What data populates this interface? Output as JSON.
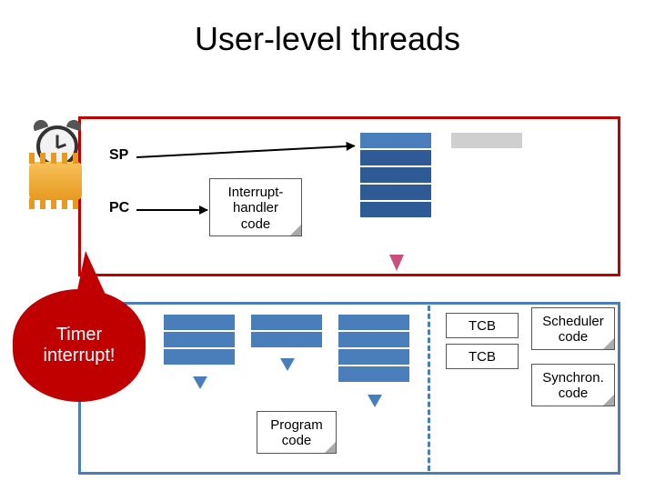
{
  "title": "User-level threads",
  "registers": {
    "sp": "SP",
    "pc": "PC"
  },
  "kernel": {
    "interrupt_handler_label": "Interrupt-\nhandler\ncode"
  },
  "balloon": {
    "text": "Timer\ninterrupt!"
  },
  "user": {
    "tcb1": "TCB",
    "tcb2": "TCB",
    "scheduler_label": "Scheduler\ncode",
    "synchron_label": "Synchron.\ncode",
    "program_label": "Program\ncode"
  }
}
